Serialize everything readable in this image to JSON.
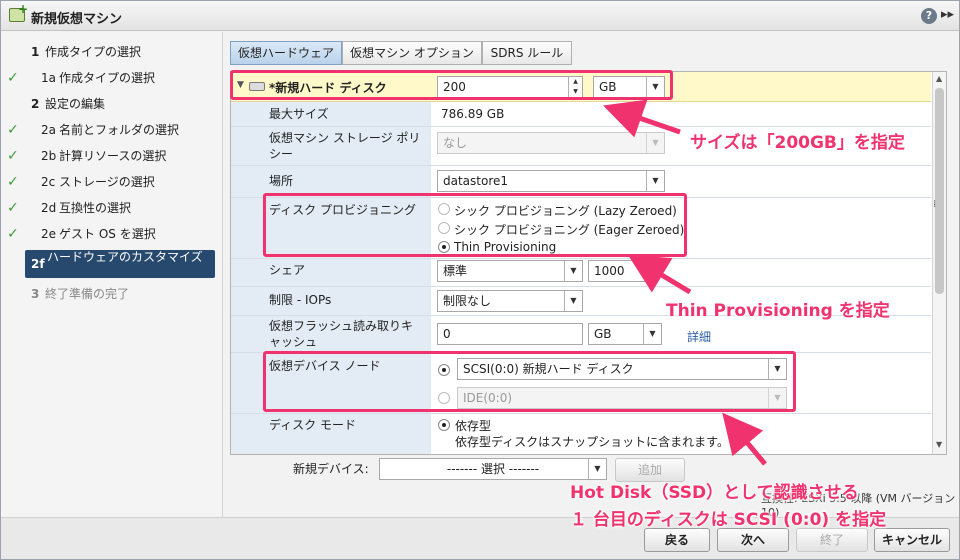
{
  "window": {
    "title": "新規仮想マシン",
    "help": "?",
    "expand": "▸▸"
  },
  "steps": [
    {
      "num": "1",
      "label": "作成タイプの選択",
      "check": false,
      "state": "normal"
    },
    {
      "num": "1a",
      "label": "作成タイプの選択",
      "check": true,
      "state": "normal"
    },
    {
      "num": "2",
      "label": "設定の編集",
      "check": false,
      "state": "normal"
    },
    {
      "num": "2a",
      "label": "名前とフォルダの選択",
      "check": true,
      "state": "normal"
    },
    {
      "num": "2b",
      "label": "計算リソースの選択",
      "check": true,
      "state": "normal"
    },
    {
      "num": "2c",
      "label": "ストレージの選択",
      "check": true,
      "state": "normal"
    },
    {
      "num": "2d",
      "label": "互換性の選択",
      "check": true,
      "state": "normal"
    },
    {
      "num": "2e",
      "label": "ゲスト OS を選択",
      "check": true,
      "state": "normal"
    },
    {
      "num": "2f",
      "label": "ハードウェアのカスタマイズ",
      "check": false,
      "state": "active"
    },
    {
      "num": "3",
      "label": "終了準備の完了",
      "check": false,
      "state": "disabled"
    }
  ],
  "tabs": [
    {
      "label": "仮想ハードウェア",
      "active": true
    },
    {
      "label": "仮想マシン オプション",
      "active": false
    },
    {
      "label": "SDRS ルール",
      "active": false
    }
  ],
  "disk": {
    "title": "*新規ハード ディスク",
    "size_value": "200",
    "size_unit": "GB",
    "max_size_label": "最大サイズ",
    "max_size_value": "786.89 GB",
    "policy_label": "仮想マシン ストレージ ポリシー",
    "policy_value": "なし",
    "location_label": "場所",
    "location_value": "datastore1",
    "provisioning_label": "ディスク プロビジョニング",
    "provisioning_options": [
      "シック プロビジョニング (Lazy Zeroed)",
      "シック プロビジョニング (Eager Zeroed)",
      "Thin Provisioning"
    ],
    "share_label": "シェア",
    "share_value": "標準",
    "share_number": "1000",
    "iops_label": "制限 - IOPs",
    "iops_value": "制限なし",
    "flash_label": "仮想フラッシュ読み取りキャッシュ",
    "flash_value": "0",
    "flash_unit": "GB",
    "flash_detail": "詳細",
    "node_label": "仮想デバイス ノード",
    "node_scsi": "SCSI(0:0) 新規ハード ディスク",
    "node_ide": "IDE(0:0)",
    "mode_label": "ディスク モード",
    "mode_value": "依存型",
    "mode_desc": "依存型ディスクはスナップショットに含まれます。"
  },
  "new_device": {
    "label": "新規デバイス:",
    "select_value": "------- 選択 -------",
    "add_button": "追加"
  },
  "compat": "互換性: ESXi 5.5 以降 (VM バージョン 10)",
  "buttons": {
    "back": "戻る",
    "next": "次へ",
    "finish": "終了",
    "cancel": "キャンセル"
  },
  "annotations": {
    "size": "サイズは「200GB」を指定",
    "thin": "Thin Provisioning を指定",
    "hotdisk_1": "Hot Disk（SSD）として認識させる",
    "hotdisk_2": "１ 台目のディスクは SCSI (0:0) を指定"
  },
  "colors": {
    "annotation": "#f0336e",
    "active_step": "#27496e",
    "header_row": "#fff8c9",
    "label_column": "#e3ecf5"
  }
}
